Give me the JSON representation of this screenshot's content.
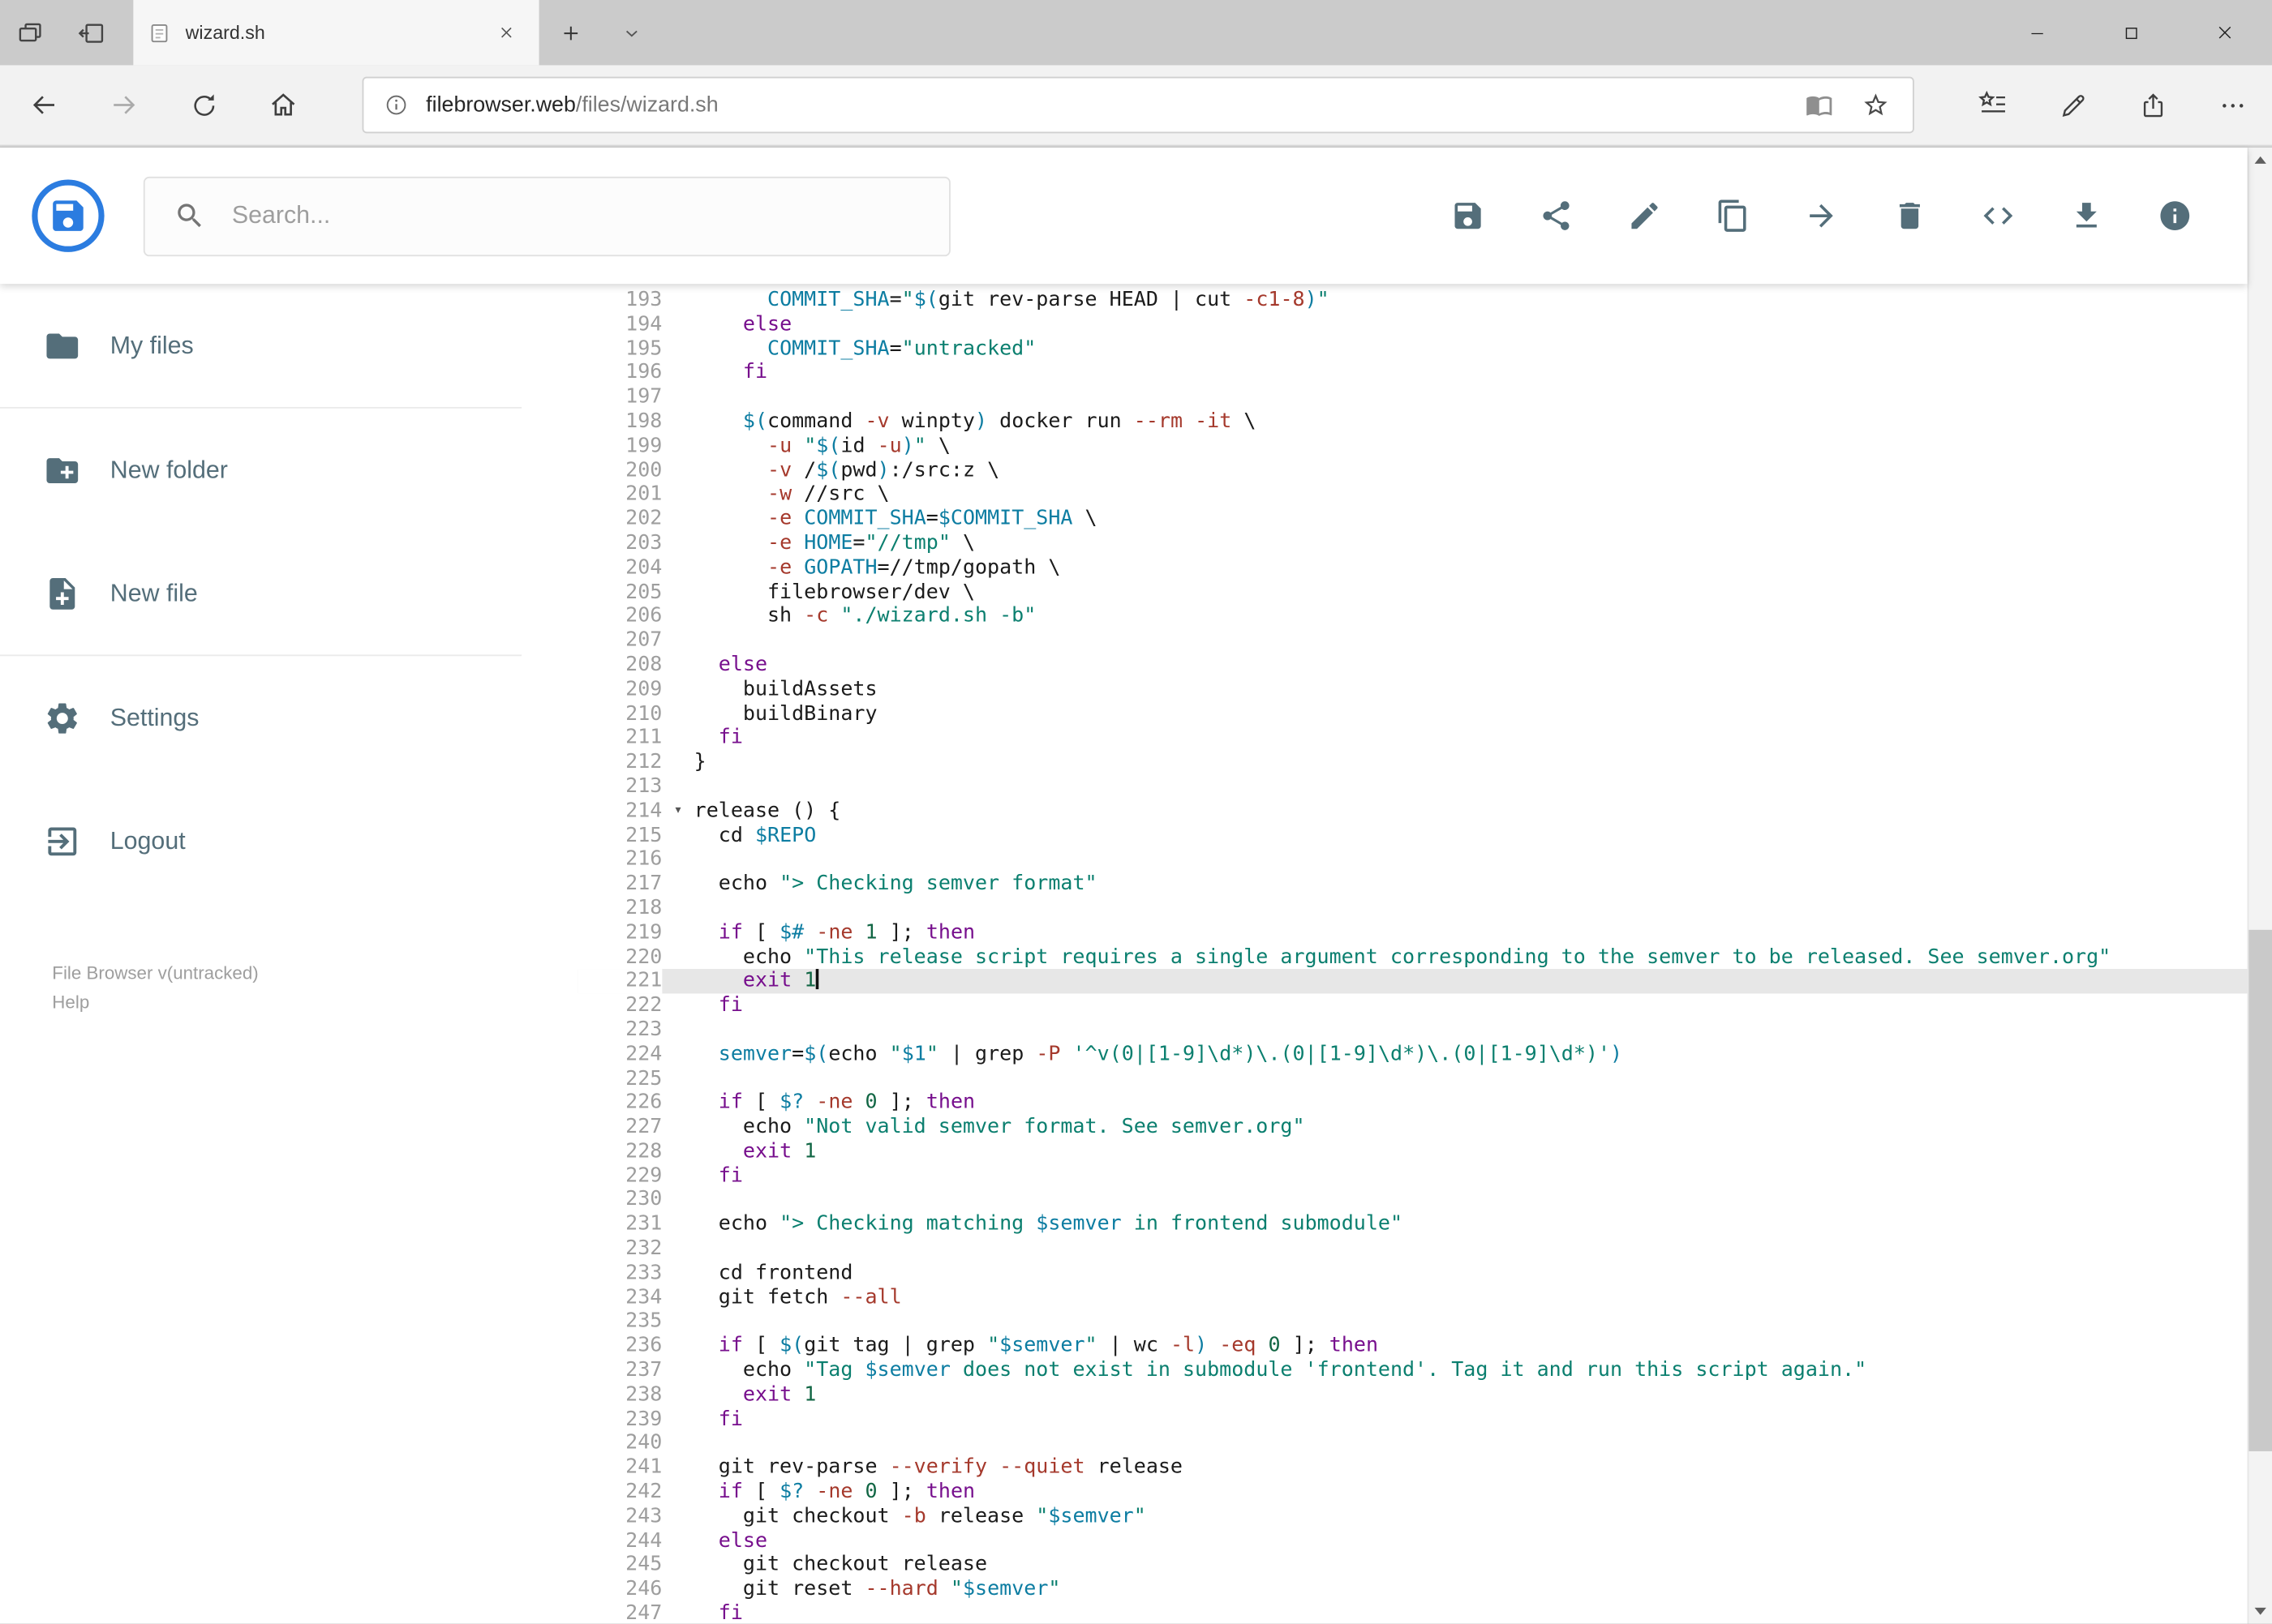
{
  "browser": {
    "tab_title": "wizard.sh",
    "url_host": "filebrowser.web",
    "url_path": "/files/wizard.sh"
  },
  "header": {
    "search_placeholder": "Search..."
  },
  "toolbar": {
    "icons": [
      "save-icon",
      "share-icon",
      "edit-icon",
      "copy-icon",
      "move-icon",
      "delete-icon",
      "code-icon",
      "download-icon",
      "info-icon"
    ]
  },
  "sidebar": {
    "items": [
      {
        "label": "My files",
        "icon": "folder-icon"
      },
      {
        "label": "New folder",
        "icon": "new-folder-icon"
      },
      {
        "label": "New file",
        "icon": "new-file-icon"
      },
      {
        "label": "Settings",
        "icon": "settings-icon"
      },
      {
        "label": "Logout",
        "icon": "logout-icon"
      }
    ],
    "footer": {
      "version": "File Browser v(untracked)",
      "help": "Help"
    }
  },
  "editor": {
    "first_line": 193,
    "last_line": 247,
    "active_line": 221,
    "cursor_line": 221,
    "fold_line": 214,
    "lines": [
      {
        "n": 193,
        "t": [
          [
            "p",
            "      "
          ],
          [
            "v",
            "COMMIT_SHA"
          ],
          [
            "p",
            "="
          ],
          [
            "s",
            "\""
          ],
          [
            "v",
            "$("
          ],
          [
            "p",
            "git rev-parse HEAD | cut "
          ],
          [
            "a",
            "-c1-8"
          ],
          [
            "v",
            ")"
          ],
          [
            "s",
            "\""
          ]
        ]
      },
      {
        "n": 194,
        "t": [
          [
            "p",
            "    "
          ],
          [
            "k",
            "else"
          ]
        ]
      },
      {
        "n": 195,
        "t": [
          [
            "p",
            "      "
          ],
          [
            "v",
            "COMMIT_SHA"
          ],
          [
            "p",
            "="
          ],
          [
            "s",
            "\"untracked\""
          ]
        ]
      },
      {
        "n": 196,
        "t": [
          [
            "p",
            "    "
          ],
          [
            "k",
            "fi"
          ]
        ]
      },
      {
        "n": 197,
        "t": []
      },
      {
        "n": 198,
        "t": [
          [
            "p",
            "    "
          ],
          [
            "v",
            "$("
          ],
          [
            "p",
            "command "
          ],
          [
            "a",
            "-v"
          ],
          [
            "p",
            " winpty"
          ],
          [
            "v",
            ")"
          ],
          [
            "p",
            " docker run "
          ],
          [
            "a",
            "--rm"
          ],
          [
            "p",
            " "
          ],
          [
            "a",
            "-it"
          ],
          [
            "p",
            " \\"
          ]
        ]
      },
      {
        "n": 199,
        "t": [
          [
            "p",
            "      "
          ],
          [
            "a",
            "-u"
          ],
          [
            "p",
            " "
          ],
          [
            "s",
            "\""
          ],
          [
            "v",
            "$("
          ],
          [
            "p",
            "id "
          ],
          [
            "a",
            "-u"
          ],
          [
            "v",
            ")"
          ],
          [
            "s",
            "\""
          ],
          [
            "p",
            " \\"
          ]
        ]
      },
      {
        "n": 200,
        "t": [
          [
            "p",
            "      "
          ],
          [
            "a",
            "-v"
          ],
          [
            "p",
            " /"
          ],
          [
            "v",
            "$("
          ],
          [
            "p",
            "pwd"
          ],
          [
            "v",
            ")"
          ],
          [
            "p",
            ":/src:z \\"
          ]
        ]
      },
      {
        "n": 201,
        "t": [
          [
            "p",
            "      "
          ],
          [
            "a",
            "-w"
          ],
          [
            "p",
            " //src \\"
          ]
        ]
      },
      {
        "n": 202,
        "t": [
          [
            "p",
            "      "
          ],
          [
            "a",
            "-e"
          ],
          [
            "p",
            " "
          ],
          [
            "v",
            "COMMIT_SHA"
          ],
          [
            "p",
            "="
          ],
          [
            "v",
            "$COMMIT_SHA"
          ],
          [
            "p",
            " \\"
          ]
        ]
      },
      {
        "n": 203,
        "t": [
          [
            "p",
            "      "
          ],
          [
            "a",
            "-e"
          ],
          [
            "p",
            " "
          ],
          [
            "v",
            "HOME"
          ],
          [
            "p",
            "="
          ],
          [
            "s",
            "\"//tmp\""
          ],
          [
            "p",
            " \\"
          ]
        ]
      },
      {
        "n": 204,
        "t": [
          [
            "p",
            "      "
          ],
          [
            "a",
            "-e"
          ],
          [
            "p",
            " "
          ],
          [
            "v",
            "GOPATH"
          ],
          [
            "p",
            "=//tmp/gopath \\"
          ]
        ]
      },
      {
        "n": 205,
        "t": [
          [
            "p",
            "      filebrowser/dev \\"
          ]
        ]
      },
      {
        "n": 206,
        "t": [
          [
            "p",
            "      sh "
          ],
          [
            "a",
            "-c"
          ],
          [
            "p",
            " "
          ],
          [
            "s",
            "\"./wizard.sh -b\""
          ]
        ]
      },
      {
        "n": 207,
        "t": []
      },
      {
        "n": 208,
        "t": [
          [
            "p",
            "  "
          ],
          [
            "k",
            "else"
          ]
        ]
      },
      {
        "n": 209,
        "t": [
          [
            "p",
            "    buildAssets"
          ]
        ]
      },
      {
        "n": 210,
        "t": [
          [
            "p",
            "    buildBinary"
          ]
        ]
      },
      {
        "n": 211,
        "t": [
          [
            "p",
            "  "
          ],
          [
            "k",
            "fi"
          ]
        ]
      },
      {
        "n": 212,
        "t": [
          [
            "p",
            "}"
          ]
        ]
      },
      {
        "n": 213,
        "t": []
      },
      {
        "n": 214,
        "t": [
          [
            "p",
            "release () {"
          ]
        ]
      },
      {
        "n": 215,
        "t": [
          [
            "p",
            "  cd "
          ],
          [
            "v",
            "$REPO"
          ]
        ]
      },
      {
        "n": 216,
        "t": []
      },
      {
        "n": 217,
        "t": [
          [
            "p",
            "  echo "
          ],
          [
            "s",
            "\"> Checking semver format\""
          ]
        ]
      },
      {
        "n": 218,
        "t": []
      },
      {
        "n": 219,
        "t": [
          [
            "p",
            "  "
          ],
          [
            "k",
            "if"
          ],
          [
            "p",
            " [ "
          ],
          [
            "v",
            "$#"
          ],
          [
            "p",
            " "
          ],
          [
            "a",
            "-ne"
          ],
          [
            "p",
            " "
          ],
          [
            "num",
            "1"
          ],
          [
            "p",
            " ]; "
          ],
          [
            "k",
            "then"
          ]
        ]
      },
      {
        "n": 220,
        "t": [
          [
            "p",
            "    echo "
          ],
          [
            "s",
            "\"This release script requires a single argument corresponding to the semver to be released. See semver.org\""
          ]
        ]
      },
      {
        "n": 221,
        "t": [
          [
            "p",
            "    "
          ],
          [
            "k",
            "exit"
          ],
          [
            "p",
            " "
          ],
          [
            "num",
            "1"
          ]
        ]
      },
      {
        "n": 222,
        "t": [
          [
            "p",
            "  "
          ],
          [
            "k",
            "fi"
          ]
        ]
      },
      {
        "n": 223,
        "t": []
      },
      {
        "n": 224,
        "t": [
          [
            "p",
            "  "
          ],
          [
            "v",
            "semver"
          ],
          [
            "p",
            "="
          ],
          [
            "v",
            "$("
          ],
          [
            "p",
            "echo "
          ],
          [
            "s",
            "\""
          ],
          [
            "v",
            "$1"
          ],
          [
            "s",
            "\""
          ],
          [
            "p",
            " | grep "
          ],
          [
            "a",
            "-P"
          ],
          [
            "p",
            " "
          ],
          [
            "s",
            "'^v(0|[1-9]\\d*)\\.(0|[1-9]\\d*)\\.(0|[1-9]\\d*)'"
          ],
          [
            "v",
            ")"
          ]
        ]
      },
      {
        "n": 225,
        "t": []
      },
      {
        "n": 226,
        "t": [
          [
            "p",
            "  "
          ],
          [
            "k",
            "if"
          ],
          [
            "p",
            " [ "
          ],
          [
            "v",
            "$?"
          ],
          [
            "p",
            " "
          ],
          [
            "a",
            "-ne"
          ],
          [
            "p",
            " "
          ],
          [
            "num",
            "0"
          ],
          [
            "p",
            " ]; "
          ],
          [
            "k",
            "then"
          ]
        ]
      },
      {
        "n": 227,
        "t": [
          [
            "p",
            "    echo "
          ],
          [
            "s",
            "\"Not valid semver format. See semver.org\""
          ]
        ]
      },
      {
        "n": 228,
        "t": [
          [
            "p",
            "    "
          ],
          [
            "k",
            "exit"
          ],
          [
            "p",
            " "
          ],
          [
            "num",
            "1"
          ]
        ]
      },
      {
        "n": 229,
        "t": [
          [
            "p",
            "  "
          ],
          [
            "k",
            "fi"
          ]
        ]
      },
      {
        "n": 230,
        "t": []
      },
      {
        "n": 231,
        "t": [
          [
            "p",
            "  echo "
          ],
          [
            "s",
            "\"> Checking matching "
          ],
          [
            "v",
            "$semver"
          ],
          [
            "s",
            " in frontend submodule\""
          ]
        ]
      },
      {
        "n": 232,
        "t": []
      },
      {
        "n": 233,
        "t": [
          [
            "p",
            "  cd frontend"
          ]
        ]
      },
      {
        "n": 234,
        "t": [
          [
            "p",
            "  git fetch "
          ],
          [
            "a",
            "--all"
          ]
        ]
      },
      {
        "n": 235,
        "t": []
      },
      {
        "n": 236,
        "t": [
          [
            "p",
            "  "
          ],
          [
            "k",
            "if"
          ],
          [
            "p",
            " [ "
          ],
          [
            "v",
            "$("
          ],
          [
            "p",
            "git tag | grep "
          ],
          [
            "s",
            "\""
          ],
          [
            "v",
            "$semver"
          ],
          [
            "s",
            "\""
          ],
          [
            "p",
            " | wc "
          ],
          [
            "a",
            "-l"
          ],
          [
            "v",
            ")"
          ],
          [
            "p",
            " "
          ],
          [
            "a",
            "-eq"
          ],
          [
            "p",
            " "
          ],
          [
            "num",
            "0"
          ],
          [
            "p",
            " ]; "
          ],
          [
            "k",
            "then"
          ]
        ]
      },
      {
        "n": 237,
        "t": [
          [
            "p",
            "    echo "
          ],
          [
            "s",
            "\"Tag "
          ],
          [
            "v",
            "$semver"
          ],
          [
            "s",
            " does not exist in submodule 'frontend'. Tag it and run this script again.\""
          ]
        ]
      },
      {
        "n": 238,
        "t": [
          [
            "p",
            "    "
          ],
          [
            "k",
            "exit"
          ],
          [
            "p",
            " "
          ],
          [
            "num",
            "1"
          ]
        ]
      },
      {
        "n": 239,
        "t": [
          [
            "p",
            "  "
          ],
          [
            "k",
            "fi"
          ]
        ]
      },
      {
        "n": 240,
        "t": []
      },
      {
        "n": 241,
        "t": [
          [
            "p",
            "  git rev-parse "
          ],
          [
            "a",
            "--verify"
          ],
          [
            "p",
            " "
          ],
          [
            "a",
            "--quiet"
          ],
          [
            "p",
            " release"
          ]
        ]
      },
      {
        "n": 242,
        "t": [
          [
            "p",
            "  "
          ],
          [
            "k",
            "if"
          ],
          [
            "p",
            " [ "
          ],
          [
            "v",
            "$?"
          ],
          [
            "p",
            " "
          ],
          [
            "a",
            "-ne"
          ],
          [
            "p",
            " "
          ],
          [
            "num",
            "0"
          ],
          [
            "p",
            " ]; "
          ],
          [
            "k",
            "then"
          ]
        ]
      },
      {
        "n": 243,
        "t": [
          [
            "p",
            "    git checkout "
          ],
          [
            "a",
            "-b"
          ],
          [
            "p",
            " release "
          ],
          [
            "s",
            "\""
          ],
          [
            "v",
            "$semver"
          ],
          [
            "s",
            "\""
          ]
        ]
      },
      {
        "n": 244,
        "t": [
          [
            "p",
            "  "
          ],
          [
            "k",
            "else"
          ]
        ]
      },
      {
        "n": 245,
        "t": [
          [
            "p",
            "    git checkout release"
          ]
        ]
      },
      {
        "n": 246,
        "t": [
          [
            "p",
            "    git reset "
          ],
          [
            "a",
            "--hard"
          ],
          [
            "p",
            " "
          ],
          [
            "s",
            "\""
          ],
          [
            "v",
            "$semver"
          ],
          [
            "s",
            "\""
          ]
        ]
      },
      {
        "n": 247,
        "t": [
          [
            "p",
            "  "
          ],
          [
            "k",
            "fi"
          ]
        ]
      }
    ]
  }
}
